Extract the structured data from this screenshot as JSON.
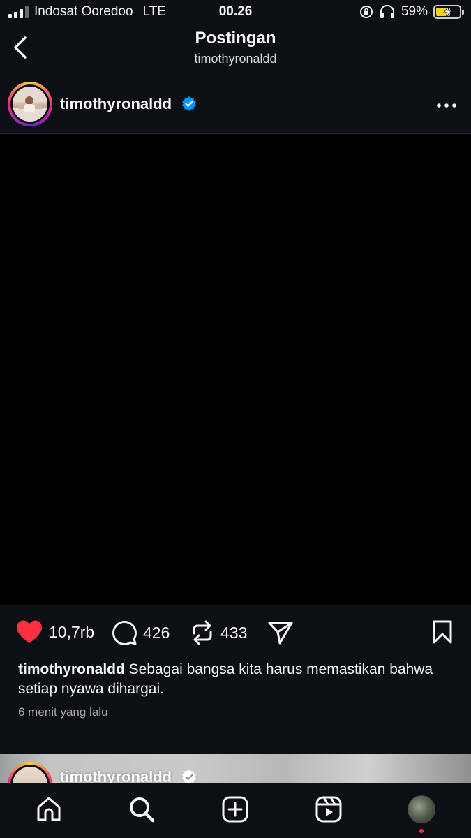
{
  "status_bar": {
    "carrier": "Indosat Ooredoo",
    "network": "LTE",
    "time": "00.26",
    "battery": "59%"
  },
  "header": {
    "title": "Postingan",
    "subtitle": "timothyronaldd"
  },
  "post": {
    "username": "timothyronaldd",
    "verified": true,
    "likes": "10,7rb",
    "comments": "426",
    "reposts": "433",
    "caption_user": "timothyronaldd",
    "caption_text": "Sebagai bangsa kita harus memastikan bahwa setiap nyawa dihargai.",
    "timestamp": "6 menit yang lalu",
    "liked": true
  },
  "next_post": {
    "username": "timothyronaldd"
  },
  "bottom_nav": {
    "items": [
      "home-icon",
      "search-icon",
      "create-icon",
      "reels-icon",
      "profile-avatar"
    ],
    "has_notification": true
  },
  "colors": {
    "background": "#0c1014",
    "like": "#ff3040",
    "verified": "#0095f6",
    "battery_fill": "#f2d21c"
  }
}
